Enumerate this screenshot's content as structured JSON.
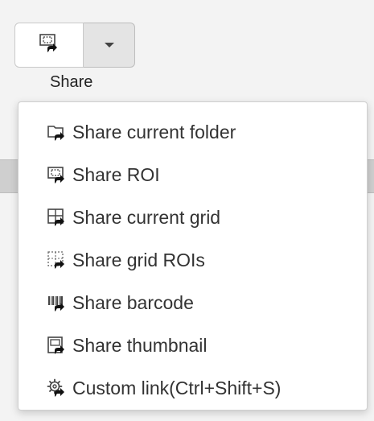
{
  "toolbar": {
    "share_label": "Share",
    "main_icon": "share-roi-icon",
    "dropdown_icon": "caret-down-icon"
  },
  "menu": {
    "items": [
      {
        "label": "Share current folder",
        "icon": "folder-share-icon"
      },
      {
        "label": "Share ROI",
        "icon": "roi-share-icon"
      },
      {
        "label": "Share current grid",
        "icon": "grid-share-icon"
      },
      {
        "label": "Share grid ROIs",
        "icon": "grid-rois-share-icon"
      },
      {
        "label": "Share barcode",
        "icon": "barcode-share-icon"
      },
      {
        "label": "Share thumbnail",
        "icon": "thumbnail-share-icon"
      },
      {
        "label": "Custom link(Ctrl+Shift+S)",
        "icon": "custom-link-icon"
      }
    ]
  }
}
